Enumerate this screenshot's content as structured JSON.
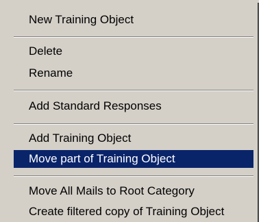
{
  "menu": {
    "items": [
      {
        "label": "New Training Object"
      },
      {
        "label": "Delete"
      },
      {
        "label": "Rename"
      },
      {
        "label": "Add Standard Responses"
      },
      {
        "label": "Add Training Object"
      },
      {
        "label": "Move part of Training Object"
      },
      {
        "label": "Move All Mails to Root Category"
      },
      {
        "label": "Create filtered copy of Training Object"
      }
    ],
    "selected_label": "Move part of Training Object"
  },
  "colors": {
    "menu_background": "#d4d0c8",
    "highlight": "#0a246a",
    "highlight_text": "#ffffff",
    "text": "#000000"
  }
}
